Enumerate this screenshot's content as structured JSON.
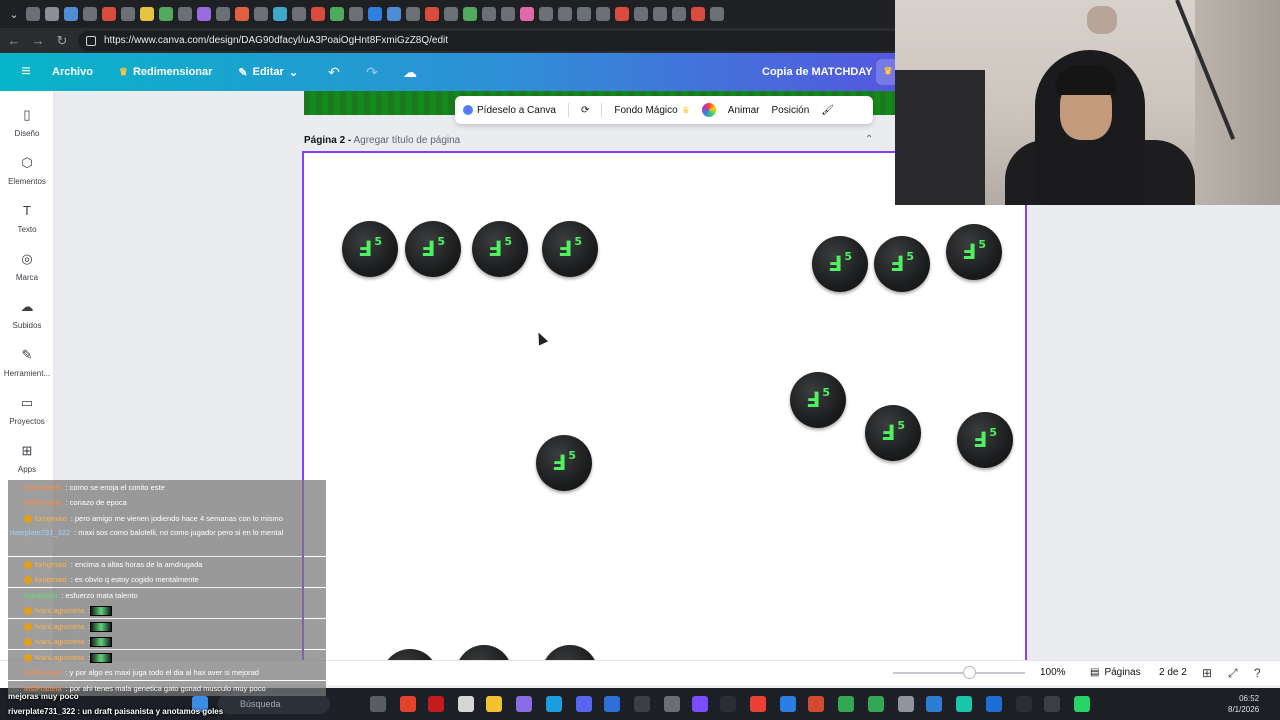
{
  "browser": {
    "url": "https://www.canva.com/design/DAG90dfacyl/uA3PoaiOgHnt8FxmiGzZ8Q/edit"
  },
  "header": {
    "archivo": "Archivo",
    "redimensionar": "Redimensionar",
    "editar": "Editar",
    "doc_title": "Copia de MATCHDAY"
  },
  "sidebar": {
    "items": [
      {
        "label": "Diseño"
      },
      {
        "label": "Elementos"
      },
      {
        "label": "Texto"
      },
      {
        "label": "Marca"
      },
      {
        "label": "Subidos"
      },
      {
        "label": "Herramient..."
      },
      {
        "label": "Proyectos"
      },
      {
        "label": "Apps"
      }
    ]
  },
  "toolbar": {
    "pideselo": "Pídeselo a Canva",
    "fondo_magico": "Fondo Mágico",
    "animar": "Animar",
    "posicion": "Posición"
  },
  "page": {
    "label_bold": "Página 2 -",
    "label_muted": "Agregar título de página"
  },
  "coin": {
    "glyph": "Ⅎ",
    "sup": "5"
  },
  "bottombar": {
    "zoom": "100%",
    "pages_label": "Páginas",
    "pages_count": "2 de 2"
  },
  "chat": {
    "lines": [
      {
        "user": "MstFranela",
        "text": ": como se enoja el conito este"
      },
      {
        "user": "MstFranela",
        "text": ": conazo de epoca"
      },
      {
        "user": "kxngmaxi",
        "text": ": pero amigo me vienen jodiendo hace 4 semanas con lo mismo"
      },
      {
        "user": "riverplate731_322",
        "text": ": maxi sos como balotelli, no como jugador pero si en lo mental"
      },
      {
        "user": "kxngmaxi",
        "text": ": encima a altas horas de la amdrugada"
      },
      {
        "user": "kxngmaxi",
        "text": ": es obvio q estoy cogido mentalmente"
      },
      {
        "user": "Agusnetin",
        "text": ": esfuerzo mata talento"
      },
      {
        "user": "IvanLagusneta",
        "text": ":"
      },
      {
        "user": "IvanLagusneta",
        "text": ":"
      },
      {
        "user": "IvanLagusneta",
        "text": ":"
      },
      {
        "user": "IvanLagusneta",
        "text": ":"
      },
      {
        "user": "MstFranela",
        "text": ": y por algo es maxi juga todo el dia al hax aver si mejorad"
      },
      {
        "user": "MstFranela",
        "text": ": por ahi tenes mala genetica gato gsnad musculo muy poco"
      }
    ],
    "bottom1": "mejoras muy poco",
    "bottom2": "riverplate731_322 : un draft paisanista y anotamos goles"
  },
  "taskbar": {
    "search": "Búsqueda",
    "time": "06:52",
    "date": "8/1/2026"
  },
  "colors": {
    "accent": "#8b3dff",
    "coin_green": "#4ff260"
  }
}
